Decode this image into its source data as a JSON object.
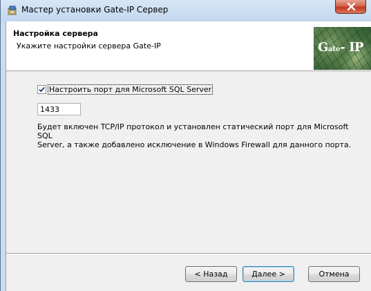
{
  "window": {
    "title": "Мастер установки Gate-IP Сервер",
    "icons": {
      "app": "installer-icon",
      "close": "close-icon"
    }
  },
  "header": {
    "title": "Настройка сервера",
    "subtitle": "Укажите настройки сервера Gate-IP",
    "logo": {
      "text_big": "G",
      "text_small": "ate",
      "text_rest": "- IP"
    }
  },
  "form": {
    "checkbox_label": "Настроить порт для Microsoft SQL Server",
    "checkbox_checked": true,
    "port_value": "1433",
    "description": "Будет включен TCP/IP протокол и установлен статический порт для Microsoft SQL\nServer, а также добавлено исключение в Windows Firewall для данного порта."
  },
  "buttons": {
    "back": "< Назад",
    "next": "Далее >",
    "cancel": "Отмена"
  },
  "colors": {
    "title_bar": "#c9dcf2",
    "close_button": "#c03a21",
    "client_background": "#f0f0f0",
    "logo_green": "#3f6a3c"
  }
}
